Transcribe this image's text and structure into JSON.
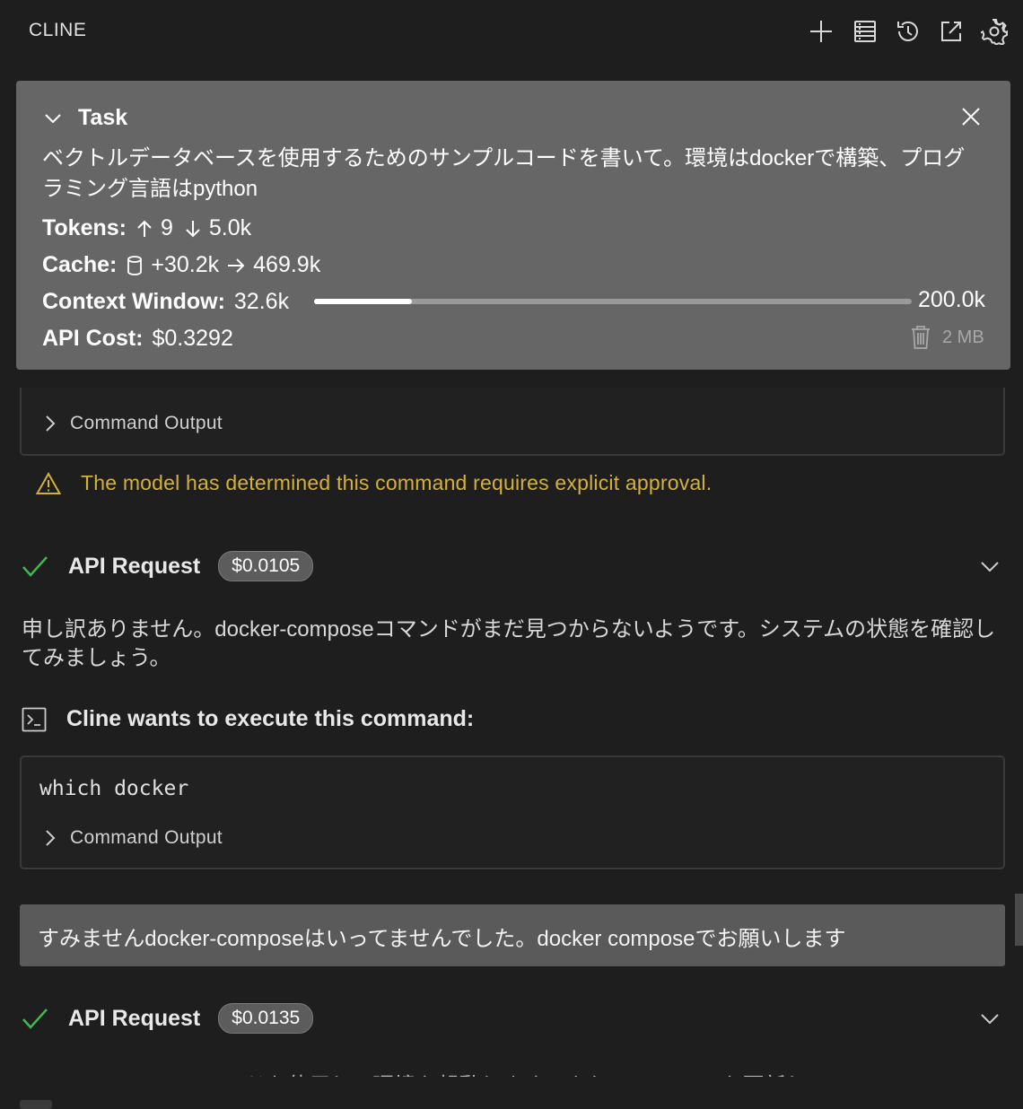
{
  "header": {
    "title": "CLINE",
    "actions": [
      "plus-icon",
      "mcp-servers-icon",
      "history-icon",
      "popout-icon",
      "gear-icon"
    ]
  },
  "task": {
    "label": "Task",
    "text": "ベクトルデータベースを使用するためのサンプルコードを書いて。環境はdockerで構築、プログラミング言語はpython",
    "tokens_label": "Tokens:",
    "tokens_in": "9",
    "tokens_out": "5.0k",
    "cache_label": "Cache:",
    "cache_write": "+30.2k",
    "cache_read": "469.9k",
    "context_label": "Context Window:",
    "context_used": "32.6k",
    "context_max": "200.0k",
    "context_fraction": 0.163,
    "cost_label": "API Cost:",
    "cost_value": "$0.3292",
    "size": "2 MB"
  },
  "feed": {
    "first_command_output": "Command Output",
    "warning": "The model has determined this command requires explicit approval.",
    "api1": {
      "label": "API Request",
      "cost": "$0.0105"
    },
    "message1": "申し訳ありません。docker-composeコマンドがまだ見つからないようです。システムの状態を確認してみましょう。",
    "exec_label": "Cline wants to execute this command:",
    "command": "which docker",
    "command_output": "Command Output",
    "user_message": "すみませんdocker-composeはいってませんでした。docker composeでお願いします",
    "api2": {
      "label": "API Request",
      "cost": "$0.0135"
    },
    "message2_cut": "docker composeコマンドを使用して環境を起動します。また、READMEも更新してdocker"
  },
  "colors": {
    "background": "#1e1e1e",
    "task_panel": "#666666",
    "warning": "#d4b13a",
    "success_check": "#3fb950",
    "user_bubble": "#5a5a5a"
  }
}
